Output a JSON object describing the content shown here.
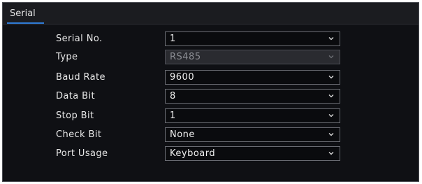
{
  "tabs": [
    {
      "label": "Serial"
    }
  ],
  "form": {
    "rows": [
      {
        "label": "Serial No.",
        "value": "1",
        "disabled": false
      },
      {
        "label": "Type",
        "value": "RS485",
        "disabled": true
      },
      {
        "label": "Baud Rate",
        "value": "9600",
        "disabled": false
      },
      {
        "label": "Data Bit",
        "value": "8",
        "disabled": false
      },
      {
        "label": "Stop Bit",
        "value": "1",
        "disabled": false
      },
      {
        "label": "Check Bit",
        "value": "None",
        "disabled": false
      },
      {
        "label": "Port Usage",
        "value": "Keyboard",
        "disabled": false
      }
    ]
  },
  "colors": {
    "accent": "#2f7bd6",
    "background": "#0f1014",
    "field_border": "#6a6c73"
  },
  "icons": {
    "dropdown": "chevron-down-icon"
  }
}
